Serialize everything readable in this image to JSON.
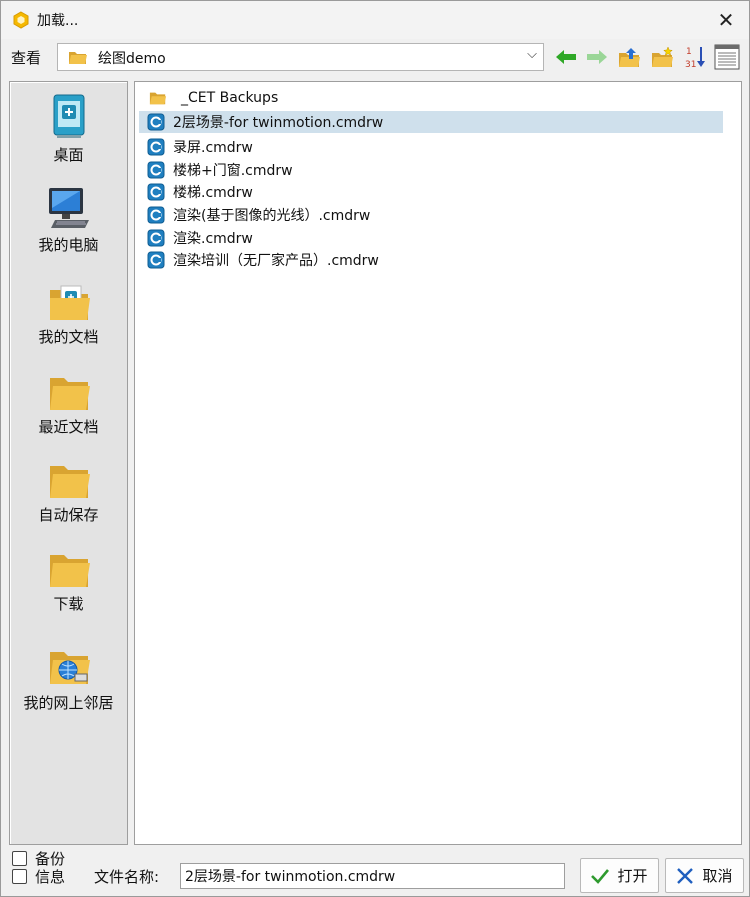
{
  "title_bar": {
    "title": "加载...",
    "close_glyph": "✕",
    "app_icon": "hexagon-app-icon"
  },
  "look_in": {
    "label": "查看",
    "current_folder": "绘图demo",
    "combo_arrow": "⌵"
  },
  "toolbar_icons": [
    "back-arrow-icon",
    "forward-arrow-icon",
    "up-folder-icon",
    "new-folder-icon",
    "sort-icon",
    "details-view-icon"
  ],
  "places": [
    {
      "label": "桌面",
      "icon": "desktop-icon"
    },
    {
      "label": "我的电脑",
      "icon": "computer-icon"
    },
    {
      "label": "我的文档",
      "icon": "documents-folder-icon"
    },
    {
      "label": "最近文档",
      "icon": "folder-icon"
    },
    {
      "label": "自动保存",
      "icon": "folder-icon"
    },
    {
      "label": "下载",
      "icon": "folder-icon"
    },
    {
      "label": "我的网上邻居",
      "icon": "network-folder-icon"
    }
  ],
  "files": [
    {
      "name": "_CET Backups",
      "type": "folder"
    },
    {
      "name": "2层场景-for twinmotion.cmdrw",
      "type": "file",
      "selected": true
    },
    {
      "name": "录屏.cmdrw",
      "type": "file"
    },
    {
      "name": "楼梯+门窗.cmdrw",
      "type": "file"
    },
    {
      "name": "楼梯.cmdrw",
      "type": "file"
    },
    {
      "name": "渲染(基于图像的光线）.cmdrw",
      "type": "file"
    },
    {
      "name": "渲染.cmdrw",
      "type": "file"
    },
    {
      "name": "渲染培训（无厂家产品）.cmdrw",
      "type": "file"
    }
  ],
  "options": {
    "backup_label": "备份",
    "info_label": "信息"
  },
  "filename": {
    "label": "文件名称:",
    "value": "2层场景-for twinmotion.cmdrw"
  },
  "buttons": {
    "open_label": "打开",
    "cancel_label": "取消"
  },
  "colors": {
    "selection": "#cfe0ec",
    "arrow_green": "#2fa827",
    "check_green": "#2e9a2e",
    "cancel_blue": "#1f5fbf",
    "folder_yellow": "#f2c24a"
  }
}
